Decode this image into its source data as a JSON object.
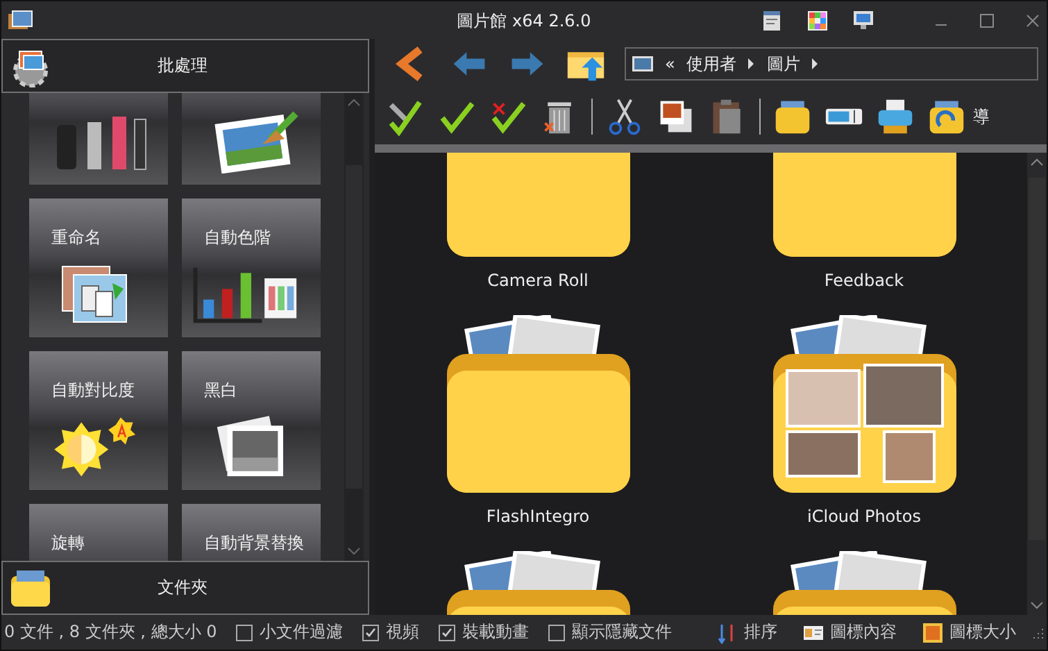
{
  "window": {
    "title": "圖片館 x64 2.6.0"
  },
  "sidebar": {
    "header": "批處理",
    "footer": "文件夾",
    "tiles": [
      {
        "kind": "makeup"
      },
      {
        "kind": "cleanup"
      },
      {
        "label": "重命名",
        "kind": "rename"
      },
      {
        "label": "自動色階",
        "kind": "levels"
      },
      {
        "label": "自動對比度",
        "kind": "contrast"
      },
      {
        "label": "黑白",
        "kind": "bw"
      },
      {
        "label": "旋轉",
        "kind": "none"
      },
      {
        "label": "自動背景替換",
        "kind": "none"
      }
    ]
  },
  "breadcrumb": {
    "lead": "«",
    "parts": [
      "使用者",
      "圖片"
    ]
  },
  "toolbar": {
    "cut_text": "導"
  },
  "folders": [
    {
      "name": "Camera Roll",
      "kind": "plain"
    },
    {
      "name": "Feedback",
      "kind": "plain"
    },
    {
      "name": "FlashIntegro",
      "kind": "stack"
    },
    {
      "name": "iCloud Photos",
      "kind": "photos"
    },
    {
      "kind": "stack"
    },
    {
      "kind": "stack"
    }
  ],
  "status_bar": {
    "summary": "0 文件 , 8 文件夾 , 總大小 0",
    "options": [
      {
        "label": "小文件過濾",
        "checked": false
      },
      {
        "label": "視頻",
        "checked": true
      },
      {
        "label": "裝載動畫",
        "checked": true
      },
      {
        "label": "顯示隱藏文件",
        "checked": false
      }
    ],
    "actions": [
      "排序",
      "圖標內容",
      "圖標大小"
    ]
  }
}
